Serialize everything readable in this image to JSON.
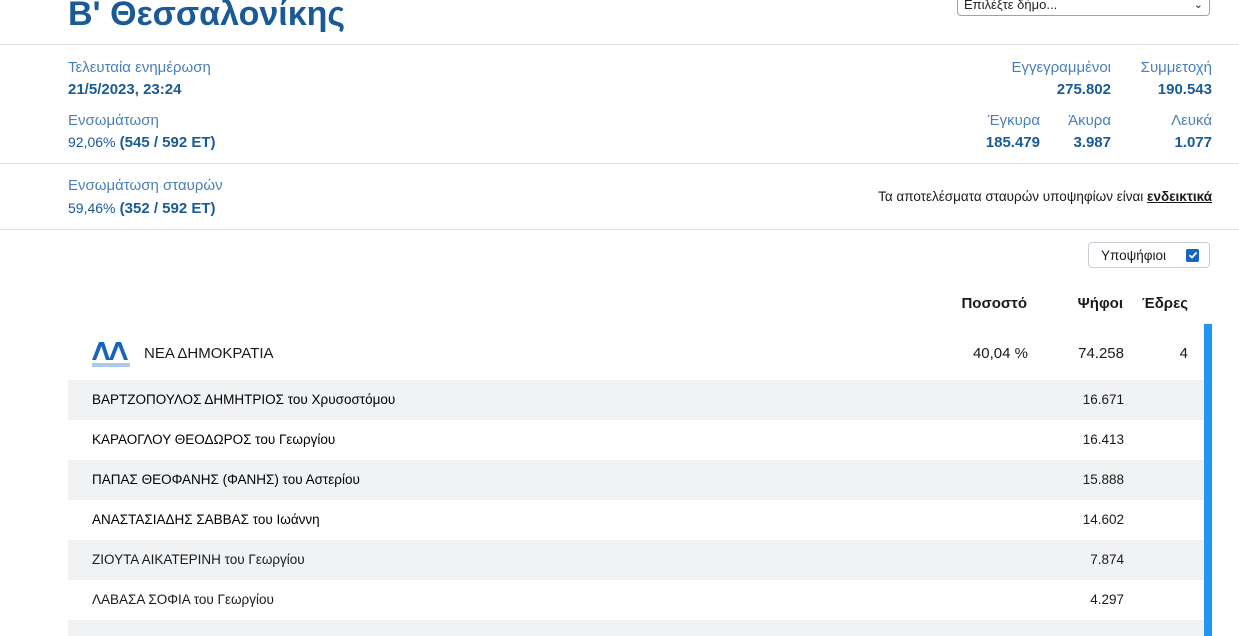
{
  "header": {
    "title": "Β' Θεσσαλονίκης",
    "select_placeholder": "Επιλέξτε δήμο..."
  },
  "stats": {
    "last_update_label": "Τελευταία ενημέρωση",
    "last_update_value": "21/5/2023, 23:24",
    "integration_label": "Ενσωμάτωση",
    "integration_pct": "92,06%",
    "integration_detail": "(545 / 592 ΕΤ)",
    "registered_label": "Εγγεγραμμένοι",
    "registered_value": "275.802",
    "turnout_label": "Συμμετοχή",
    "turnout_value": "190.543",
    "valid_label": "Έγκυρα",
    "valid_value": "185.479",
    "invalid_label": "Άκυρα",
    "invalid_value": "3.987",
    "blank_label": "Λευκά",
    "blank_value": "1.077",
    "cross_label": "Ενσωμάτωση σταυρών",
    "cross_pct": "59,46%",
    "cross_detail": "(352 / 592 ΕΤ)",
    "notice_text": "Τα αποτελέσματα σταυρών υποψηφίων είναι ",
    "notice_link": "ενδεικτικά"
  },
  "controls": {
    "candidates_toggle_label": "Υποψήφιοι",
    "candidates_checked": true,
    "checkbox_color": "#1565c0"
  },
  "table": {
    "headers": {
      "percentage": "Ποσοστό",
      "votes": "Ψήφοι",
      "seats": "Έδρες"
    },
    "party": {
      "name": "ΝΕΑ ΔΗΜΟΚΡΑΤΙΑ",
      "logo_text": "ΝΔ",
      "logo_caption": "ΝΕΑ ΔΗΜΟΚΡΑΤΙΑ",
      "percentage": "40,04 %",
      "votes": "74.258",
      "seats": "4",
      "color": "#2196f3"
    },
    "candidates": [
      {
        "name": "ΒΑΡΤΖΟΠΟΥΛΟΣ ΔΗΜΗΤΡΙΟΣ του Χρυσοστόμου",
        "votes": "16.671"
      },
      {
        "name": "ΚΑΡΑΟΓΛΟΥ ΘΕΟΔΩΡΟΣ του Γεωργίου",
        "votes": "16.413"
      },
      {
        "name": "ΠΑΠΑΣ ΘΕΟΦΑΝΗΣ (ΦΑΝΗΣ) του Αστερίου",
        "votes": "15.888"
      },
      {
        "name": "ΑΝΑΣΤΑΣΙΑΔΗΣ ΣΑΒΒΑΣ του Ιωάννη",
        "votes": "14.602"
      },
      {
        "name": "ΖΙΟΥΤΑ ΑΙΚΑΤΕΡΙΝΗ του Γεωργίου",
        "votes": "7.874"
      },
      {
        "name": "ΛΑΒΑΣΑ ΣΟΦΙΑ του Γεωργίου",
        "votes": "4.297"
      }
    ]
  }
}
